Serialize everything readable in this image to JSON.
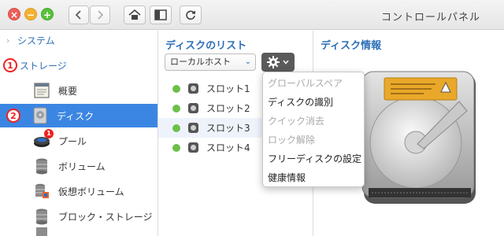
{
  "window": {
    "title": "コントロールパネル",
    "controls": {
      "close_symbol": "×",
      "minimize_symbol": "−",
      "zoom_symbol": "+"
    }
  },
  "toolbar": {
    "back_icon": "chevron-left-icon",
    "forward_icon": "chevron-right-icon",
    "home_icon": "home-icon",
    "sidebar_toggle_icon": "sidebar-icon",
    "reload_icon": "reload-icon"
  },
  "sidebar": {
    "system_label": "システム",
    "storage_marker": "1",
    "storage_label": "ストレージ",
    "items": [
      {
        "label": "概要",
        "icon": "overview-icon"
      },
      {
        "label": "ディスク",
        "icon": "disk-icon",
        "selected": true,
        "marker": "2"
      },
      {
        "label": "プール",
        "icon": "pool-icon",
        "badge": "1"
      },
      {
        "label": "ボリューム",
        "icon": "volume-icon"
      },
      {
        "label": "仮想ボリューム",
        "icon": "virtual-volume-icon"
      },
      {
        "label": "ブロック・ストレージ",
        "icon": "block-storage-icon"
      }
    ]
  },
  "disk_list": {
    "title": "ディスクのリスト",
    "host_select": "ローカルホスト",
    "slots": [
      "スロット1",
      "スロット2",
      "スロット3",
      "スロット4"
    ],
    "status_color": "#6cc04a"
  },
  "menu": {
    "items": [
      {
        "label": "グローバルスペア",
        "enabled": false
      },
      {
        "label": "ディスクの識別",
        "enabled": true
      },
      {
        "label": "クイック消去",
        "enabled": false
      },
      {
        "label": "ロック解除",
        "enabled": false
      },
      {
        "label": "フリーディスクの設定",
        "enabled": true
      },
      {
        "label": "健康情報",
        "enabled": true
      }
    ]
  },
  "disk_info": {
    "title": "ディスク情報"
  },
  "colors": {
    "accent": "#2f6fb6",
    "selected_bg": "#3b86e3",
    "marker_red": "#e22222"
  }
}
